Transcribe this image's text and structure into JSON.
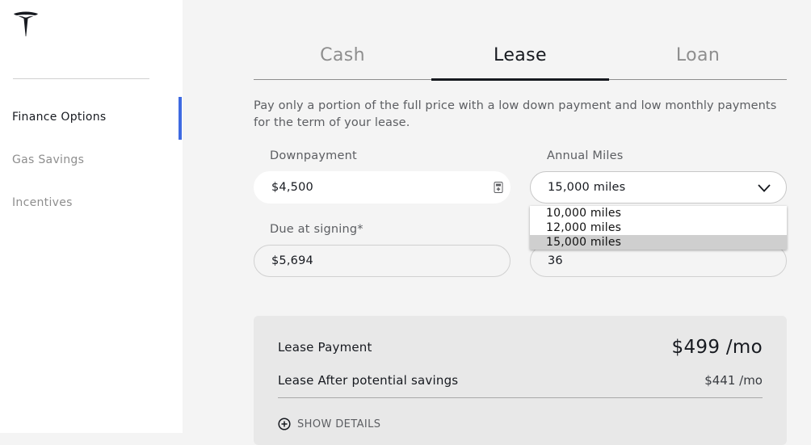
{
  "brand": {
    "logo_icon": "tesla-t-logo"
  },
  "sidebar": {
    "items": [
      {
        "label": "Finance Options",
        "active": true
      },
      {
        "label": "Gas Savings",
        "active": false
      },
      {
        "label": "Incentives",
        "active": false
      }
    ],
    "accent_color": "#3e6ae1"
  },
  "tabs": [
    {
      "label": "Cash",
      "active": false
    },
    {
      "label": "Lease",
      "active": true
    },
    {
      "label": "Loan",
      "active": false
    }
  ],
  "description": "Pay only a portion of the full price with a low down payment and low monthly payments for the term of your lease.",
  "form": {
    "downpayment": {
      "label": "Downpayment",
      "value": "$4,500",
      "icon": "calculator-icon"
    },
    "annual_miles": {
      "label": "Annual Miles",
      "value": "15,000 miles",
      "icon": "chevron-down-icon",
      "options": [
        "10,000 miles",
        "12,000 miles",
        "15,000 miles"
      ],
      "selected_index": 2
    },
    "due_at_signing": {
      "label": "Due at signing*",
      "value": "$5,694"
    },
    "term": {
      "value": "36"
    }
  },
  "summary": {
    "lease_payment": {
      "label": "Lease Payment",
      "value": "$499 /mo"
    },
    "after_savings": {
      "label": "Lease After potential savings",
      "value": "$441 /mo"
    },
    "details_label": "SHOW DETAILS",
    "details_icon": "plus-circle-icon"
  }
}
